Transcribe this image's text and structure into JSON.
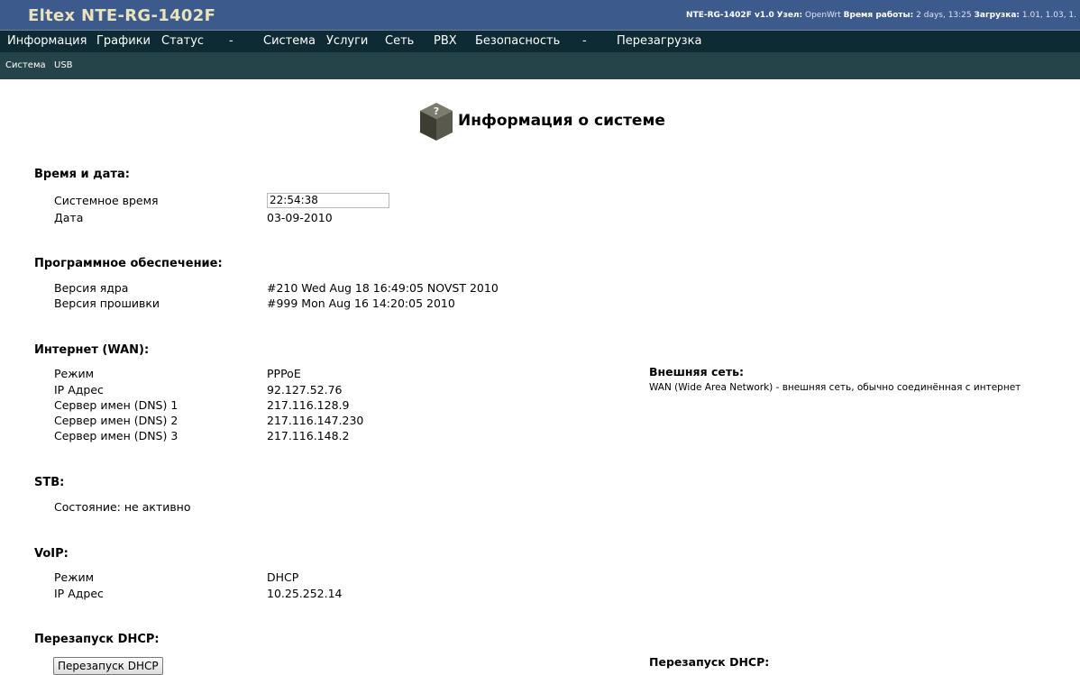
{
  "header": {
    "brand": "Eltex NTE-RG-1402F",
    "status": {
      "model": "NTE-RG-1402F v1.0",
      "node_label": "Узел:",
      "node_value": "OpenWrt",
      "uptime_label": "Время работы:",
      "uptime_value": "2 days, 13:25",
      "load_label": "Загрузка:",
      "load_value": "1.01, 1.03, 1."
    }
  },
  "menu": {
    "items": [
      "Информация",
      "Графики",
      "Статус",
      "-",
      "Система",
      "Услуги",
      "Сеть",
      "PBX",
      "Безопасность",
      "-",
      "Перезагрузка"
    ]
  },
  "submenu": {
    "items": [
      "Система",
      "USB"
    ]
  },
  "page": {
    "title": "Информация о системе",
    "icon": "help-cube-icon"
  },
  "time_date": {
    "heading": "Время и дата:",
    "system_time_label": "Системное время",
    "system_time_value": "22:54:38",
    "date_label": "Дата",
    "date_value": "03-09-2010"
  },
  "software": {
    "heading": "Программное обеспечение:",
    "kernel_label": "Версия ядра",
    "kernel_value": "#210 Wed Aug 18 16:49:05 NOVST 2010",
    "firmware_label": "Версия прошивки",
    "firmware_value": "#999 Mon Aug 16 14:20:05 2010"
  },
  "wan": {
    "heading": "Интернет (WAN):",
    "rows": [
      {
        "label": "Режим",
        "value": "PPPoE"
      },
      {
        "label": "IP Адрес",
        "value": "92.127.52.76"
      },
      {
        "label": "Сервер имен (DNS) 1",
        "value": "217.116.128.9"
      },
      {
        "label": "Сервер имен (DNS) 2",
        "value": "217.116.147.230"
      },
      {
        "label": "Сервер имен (DNS) 3",
        "value": "217.116.148.2"
      }
    ]
  },
  "stb": {
    "heading": "STB:",
    "state": "Состояние: не активно"
  },
  "voip": {
    "heading": "VoIP:",
    "rows": [
      {
        "label": "Режим",
        "value": "DHCP"
      },
      {
        "label": "IP Адрес",
        "value": "10.25.252.14"
      }
    ]
  },
  "dhcp": {
    "heading": "Перезапуск DHCP:",
    "button_label": "Перезапуск DHCP"
  },
  "help": {
    "wan_title": "Внешняя сеть:",
    "wan_text": "WAN (Wide Area Network) - внешняя сеть, обычно соединённая с интернет",
    "dhcp_title": "Перезапуск DHCP:"
  }
}
